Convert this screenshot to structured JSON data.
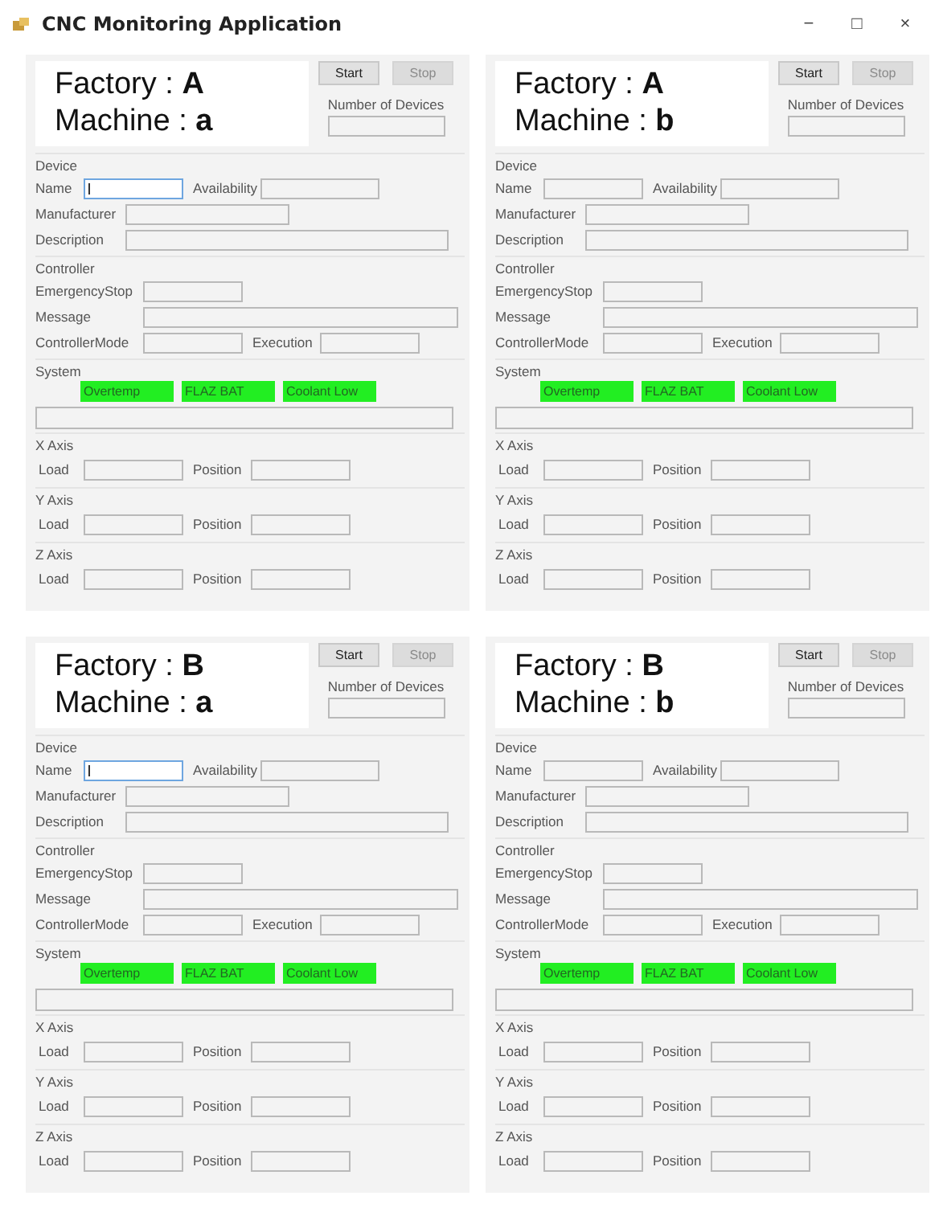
{
  "window": {
    "title": "CNC Monitoring Application",
    "controls": [
      "−",
      "□",
      "×"
    ]
  },
  "panels": [
    {
      "factory": "Factory : **A**",
      "machine": "Machine : **a**",
      "start_button": {
        "label": "Start",
        "disabled": false
      },
      "stop_button": {
        "label": "Stop",
        "disabled": true
      },
      "devices_label": "Number of Devices",
      "device": {
        "title": "Device",
        "name": {
          "label": "Name",
          "focused": true
        },
        "availability": {
          "label": "Availability"
        },
        "manufacturer": {
          "label": "Manufacturer"
        },
        "description": {
          "label": "Description"
        }
      },
      "controller": {
        "title": "Controller",
        "emergency_stop": {
          "label": "EmergencyStop"
        },
        "message": {
          "label": "Message"
        },
        "controller_mode": {
          "label": "ControllerMode"
        },
        "execution": {
          "label": "Execution"
        }
      },
      "system": {
        "title": "System",
        "indicators": [
          {
            "label": "Overtemp"
          },
          {
            "label": "FLAZ BAT"
          },
          {
            "label": "Coolant Low"
          }
        ]
      },
      "axes": [
        {
          "title": "X Axis",
          "load": "Load",
          "position": "Position"
        },
        {
          "title": "Y Axis",
          "load": "Load",
          "position": "Position"
        },
        {
          "title": "Z Axis",
          "load": "Load",
          "position": "Position"
        }
      ]
    },
    {
      "factory": "Factory : **A**",
      "machine": "Machine : **b**",
      "start_button": {
        "label": "Start",
        "disabled": false
      },
      "stop_button": {
        "label": "Stop",
        "disabled": true
      },
      "devices_label": "Number of Devices",
      "device": {
        "title": "Device",
        "name": {
          "label": "Name",
          "focused": false
        },
        "availability": {
          "label": "Availability"
        },
        "manufacturer": {
          "label": "Manufacturer"
        },
        "description": {
          "label": "Description"
        }
      },
      "controller": {
        "title": "Controller",
        "emergency_stop": {
          "label": "EmergencyStop"
        },
        "message": {
          "label": "Message"
        },
        "controller_mode": {
          "label": "ControllerMode"
        },
        "execution": {
          "label": "Execution"
        }
      },
      "system": {
        "title": "System",
        "indicators": [
          {
            "label": "Overtemp"
          },
          {
            "label": "FLAZ BAT"
          },
          {
            "label": "Coolant Low"
          }
        ]
      },
      "axes": [
        {
          "title": "X Axis",
          "load": "Load",
          "position": "Position"
        },
        {
          "title": "Y Axis",
          "load": "Load",
          "position": "Position"
        },
        {
          "title": "Z Axis",
          "load": "Load",
          "position": "Position"
        }
      ]
    },
    {
      "factory": "Factory : **B**",
      "machine": "Machine : **a**",
      "start_button": {
        "label": "Start",
        "disabled": false
      },
      "stop_button": {
        "label": "Stop",
        "disabled": true
      },
      "devices_label": "Number of Devices",
      "device": {
        "title": "Device",
        "name": {
          "label": "Name",
          "focused": true
        },
        "availability": {
          "label": "Availability"
        },
        "manufacturer": {
          "label": "Manufacturer"
        },
        "description": {
          "label": "Description"
        }
      },
      "controller": {
        "title": "Controller",
        "emergency_stop": {
          "label": "EmergencyStop"
        },
        "message": {
          "label": "Message"
        },
        "controller_mode": {
          "label": "ControllerMode"
        },
        "execution": {
          "label": "Execution"
        }
      },
      "system": {
        "title": "System",
        "indicators": [
          {
            "label": "Overtemp"
          },
          {
            "label": "FLAZ BAT"
          },
          {
            "label": "Coolant Low"
          }
        ]
      },
      "axes": [
        {
          "title": "X Axis",
          "load": "Load",
          "position": "Position"
        },
        {
          "title": "Y Axis",
          "load": "Load",
          "position": "Position"
        },
        {
          "title": "Z Axis",
          "load": "Load",
          "position": "Position"
        }
      ]
    },
    {
      "factory": "Factory : **B**",
      "machine": "Machine : **b**",
      "start_button": {
        "label": "Start",
        "disabled": false
      },
      "stop_button": {
        "label": "Stop",
        "disabled": true
      },
      "devices_label": "Number of Devices",
      "device": {
        "title": "Device",
        "name": {
          "label": "Name",
          "focused": false
        },
        "availability": {
          "label": "Availability"
        },
        "manufacturer": {
          "label": "Manufacturer"
        },
        "description": {
          "label": "Description"
        }
      },
      "controller": {
        "title": "Controller",
        "emergency_stop": {
          "label": "EmergencyStop"
        },
        "message": {
          "label": "Message"
        },
        "controller_mode": {
          "label": "ControllerMode"
        },
        "execution": {
          "label": "Execution"
        }
      },
      "system": {
        "title": "System",
        "indicators": [
          {
            "label": "Overtemp"
          },
          {
            "label": "FLAZ BAT"
          },
          {
            "label": "Coolant Low"
          }
        ]
      },
      "axes": [
        {
          "title": "X Axis",
          "load": "Load",
          "position": "Position"
        },
        {
          "title": "Y Axis",
          "load": "Load",
          "position": "Position"
        },
        {
          "title": "Z Axis",
          "load": "Load",
          "position": "Position"
        }
      ]
    }
  ]
}
